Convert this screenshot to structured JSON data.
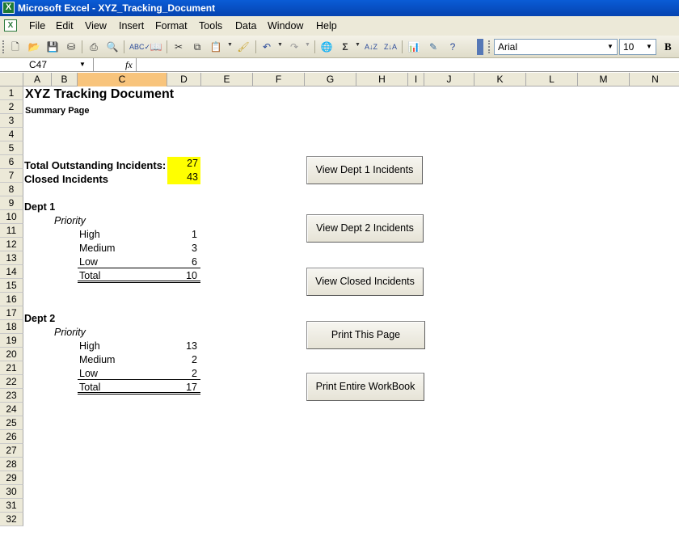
{
  "window": {
    "title": "Microsoft Excel - XYZ_Tracking_Document"
  },
  "menu": [
    "File",
    "Edit",
    "View",
    "Insert",
    "Format",
    "Tools",
    "Data",
    "Window",
    "Help"
  ],
  "toolbar": {
    "icons": [
      "new-icon",
      "open-icon",
      "save-icon",
      "permission-icon",
      "print-icon",
      "print-preview-icon",
      "spelling-icon",
      "research-icon",
      "cut-icon",
      "copy-icon",
      "paste-icon",
      "format-painter-icon",
      "undo-icon",
      "redo-icon",
      "hyperlink-icon",
      "autosum-icon",
      "sort-ascending-icon",
      "sort-descending-icon",
      "chart-wizard-icon",
      "drawing-icon",
      "help-icon"
    ],
    "font_name": "Arial",
    "font_size": "10",
    "bold_label": "B"
  },
  "formula_bar": {
    "name_box": "C47",
    "fx_label": "fx",
    "value": ""
  },
  "columns": [
    "A",
    "B",
    "C",
    "D",
    "E",
    "F",
    "G",
    "H",
    "I",
    "J",
    "K",
    "L",
    "M",
    "N"
  ],
  "selected_column": "C",
  "rows": [
    "1",
    "2",
    "3",
    "4",
    "5",
    "6",
    "7",
    "8",
    "9",
    "10",
    "11",
    "12",
    "13",
    "14",
    "15",
    "16",
    "17",
    "18",
    "19",
    "20",
    "21",
    "22",
    "23",
    "24",
    "25",
    "26",
    "27",
    "28",
    "29",
    "30",
    "31",
    "32"
  ],
  "sheet": {
    "title": "XYZ Tracking Document",
    "subtitle": "Summary Page",
    "total_outstanding_label": "Total Outstanding Incidents:",
    "total_outstanding_value": "27",
    "closed_label": "Closed Incidents",
    "closed_value": "43",
    "dept1": {
      "label": "Dept 1",
      "priority_label": "Priority",
      "rows": [
        {
          "label": "High",
          "value": "1"
        },
        {
          "label": "Medium",
          "value": "3"
        },
        {
          "label": "Low",
          "value": "6"
        }
      ],
      "total_label": "Total",
      "total_value": "10"
    },
    "dept2": {
      "label": "Dept 2",
      "priority_label": "Priority",
      "rows": [
        {
          "label": "High",
          "value": "13"
        },
        {
          "label": "Medium",
          "value": "2"
        },
        {
          "label": "Low",
          "value": "2"
        }
      ],
      "total_label": "Total",
      "total_value": "17"
    },
    "highlight_color": "#ffff00"
  },
  "buttons": {
    "view_dept1": "View Dept 1 Incidents",
    "view_dept2": "View Dept 2 Incidents",
    "view_closed": "View Closed Incidents",
    "print_page": "Print This Page",
    "print_workbook": "Print Entire WorkBook"
  }
}
